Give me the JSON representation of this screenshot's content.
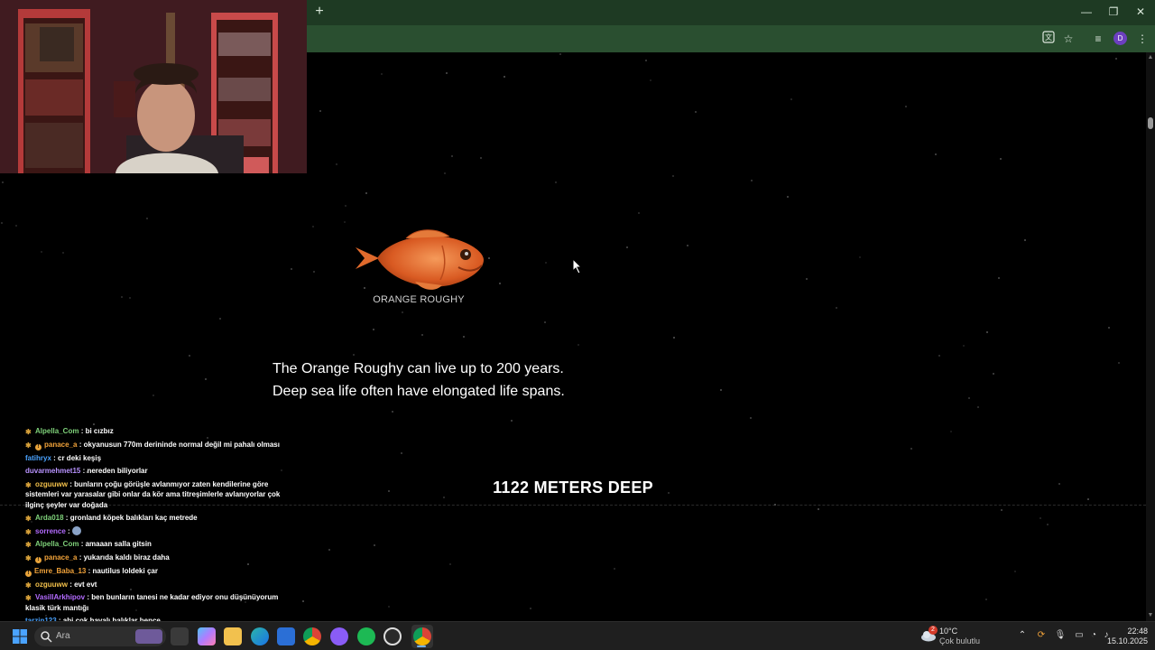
{
  "browser": {
    "new_tab_icon": "plus-icon",
    "window_controls": [
      "minimize-icon",
      "restore-icon",
      "close-icon"
    ],
    "toolbar_icons": [
      "translate-icon",
      "bookmark-star-icon",
      "tab-search-icon",
      "profile-avatar",
      "kebab-menu-icon"
    ],
    "profile_initial": "D",
    "accent": "#2a4f30"
  },
  "page": {
    "creature": {
      "name": "ORANGE ROUGHY",
      "color": "#e0662c"
    },
    "fact_line_1": "The Orange Roughy can live up to 200 years.",
    "fact_line_2": "Deep sea life often have elongated life spans.",
    "depth_label": "1122 METERS DEEP"
  },
  "chat": {
    "messages": [
      {
        "user": "Alpella_Com",
        "text": " : bi cızbız",
        "color": "#7fd27a",
        "badges": [
          "star"
        ]
      },
      {
        "user": "panace_a",
        "text": " : okyanusun 770m derininde normal değil mi pahalı olması",
        "color": "#f2a33a",
        "badges": [
          "star",
          "warn"
        ]
      },
      {
        "user": "fatihryx",
        "text": " : cr deki keşiş",
        "color": "#4aa3ff",
        "badges": []
      },
      {
        "user": "duvarmehmet15",
        "text": " : nereden biliyorlar",
        "color": "#b893ff",
        "badges": []
      },
      {
        "user": "ozguuww",
        "text": " : bunların çoğu görüşle avlanmıyor zaten kendilerine göre sistemleri var yarasalar gibi onlar da kör ama titreşimlerle avlanıyorlar çok ilginç şeyler var doğada",
        "color": "#f2c04a",
        "badges": [
          "star"
        ]
      },
      {
        "user": "Arda018",
        "text": " : gronland köpek balıkları kaç metrede",
        "color": "#7fd27a",
        "badges": [
          "star"
        ]
      },
      {
        "user": "sorrence",
        "text": " : ",
        "color": "#b36bff",
        "badges": [
          "star"
        ],
        "sticker": "earth-emote"
      },
      {
        "user": "Alpella_Com",
        "text": " : amaaan salla gitsin",
        "color": "#7fd27a",
        "badges": [
          "star"
        ]
      },
      {
        "user": "panace_a",
        "text": " : yukarıda kaldı biraz daha",
        "color": "#f2a33a",
        "badges": [
          "star",
          "warn"
        ]
      },
      {
        "user": "Emre_Baba_13",
        "text": " : nautilus loldeki çar",
        "color": "#f2a33a",
        "badges": [
          "warn"
        ]
      },
      {
        "user": "ozguuww",
        "text": " : evt evt",
        "color": "#f2c04a",
        "badges": [
          "star"
        ]
      },
      {
        "user": "VasillArkhipov",
        "text": " : ben bunların tanesi ne kadar ediyor onu düşünüyorum klasik türk mantığı",
        "color": "#b36bff",
        "badges": [
          "star"
        ]
      },
      {
        "user": "tarzin123",
        "text": " : abi çok havalı balıklar bence",
        "color": "#4aa3ff",
        "badges": []
      }
    ]
  },
  "taskbar": {
    "search_placeholder": "Ara",
    "apps": [
      "file-explorer-icon",
      "copilot-icon",
      "folder-icon",
      "edge-icon",
      "store-icon",
      "chrome-icon",
      "discord-icon",
      "spotify-icon",
      "obs-icon",
      "chrome-profile-icon"
    ],
    "weather": {
      "temp": "10°C",
      "desc": "Çok bulutlu",
      "badge": "2"
    },
    "tray_icons": [
      "chevron-up-icon",
      "sync-icon",
      "microphone-icon",
      "display-icon",
      "wifi-icon",
      "volume-icon"
    ],
    "time": "22:48",
    "date": "15.10.2025"
  }
}
